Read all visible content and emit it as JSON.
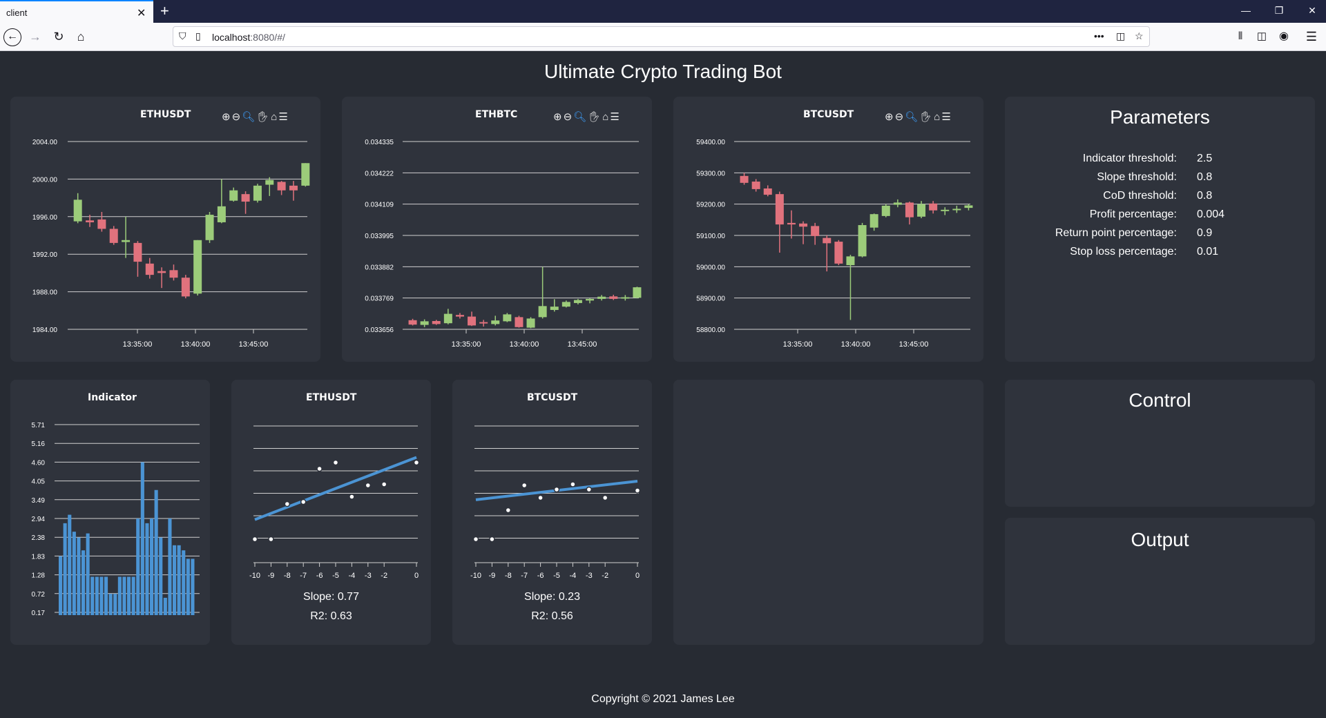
{
  "browser": {
    "tab_title": "client",
    "url_host": "localhost",
    "url_rest": ":8080/#/"
  },
  "app": {
    "title": "Ultimate Crypto Trading Bot",
    "footer": "Copyright © 2021 James Lee"
  },
  "colors": {
    "bull": "#9ccc7a",
    "bear": "#e1727d",
    "line": "#4b94d4",
    "background": "#272b33",
    "card": "#2f333c"
  },
  "parameters": {
    "title": "Parameters",
    "rows": [
      {
        "label": "Indicator threshold:",
        "value": "2.5"
      },
      {
        "label": "Slope threshold:",
        "value": "0.8"
      },
      {
        "label": "CoD threshold:",
        "value": "0.8"
      },
      {
        "label": "Profit percentage:",
        "value": "0.004"
      },
      {
        "label": "Return point percentage:",
        "value": "0.9"
      },
      {
        "label": "Stop loss percentage:",
        "value": "0.01"
      }
    ]
  },
  "control": {
    "title": "Control"
  },
  "output": {
    "title": "Output"
  },
  "chart_data": [
    {
      "type": "candlestick",
      "title": "ETHUSDT",
      "y_ticks": [
        "2004.00",
        "2000.00",
        "1996.00",
        "1992.00",
        "1988.00",
        "1984.00"
      ],
      "ylim": [
        1984,
        2004
      ],
      "x_ticks": [
        "13:35:00",
        "13:40:00",
        "13:45:00"
      ],
      "candles": [
        {
          "o": 1995.5,
          "h": 1998.5,
          "l": 1995.3,
          "c": 1997.8
        },
        {
          "o": 1995.6,
          "h": 1996.2,
          "l": 1994.9,
          "c": 1995.4
        },
        {
          "o": 1995.7,
          "h": 1996.5,
          "l": 1994.4,
          "c": 1994.7
        },
        {
          "o": 1994.7,
          "h": 1995.0,
          "l": 1993.0,
          "c": 1993.2
        },
        {
          "o": 1993.3,
          "h": 1996.0,
          "l": 1991.6,
          "c": 1993.5
        },
        {
          "o": 1993.2,
          "h": 1993.4,
          "l": 1989.6,
          "c": 1991.2
        },
        {
          "o": 1991.0,
          "h": 1991.6,
          "l": 1989.4,
          "c": 1989.8
        },
        {
          "o": 1990.2,
          "h": 1990.6,
          "l": 1988.4,
          "c": 1990.0
        },
        {
          "o": 1990.3,
          "h": 1990.9,
          "l": 1989.2,
          "c": 1989.5
        },
        {
          "o": 1989.5,
          "h": 1989.8,
          "l": 1987.3,
          "c": 1987.5
        },
        {
          "o": 1987.8,
          "h": 1993.5,
          "l": 1987.6,
          "c": 1993.5
        },
        {
          "o": 1993.5,
          "h": 1996.5,
          "l": 1993.2,
          "c": 1996.2
        },
        {
          "o": 1995.4,
          "h": 2000.0,
          "l": 1995.3,
          "c": 1997.1
        },
        {
          "o": 1997.7,
          "h": 1999.1,
          "l": 1997.6,
          "c": 1998.8
        },
        {
          "o": 1998.4,
          "h": 1998.7,
          "l": 1996.3,
          "c": 1997.6
        },
        {
          "o": 1997.7,
          "h": 1999.5,
          "l": 1997.5,
          "c": 1999.3
        },
        {
          "o": 1999.4,
          "h": 2000.2,
          "l": 1998.2,
          "c": 1999.9
        },
        {
          "o": 1999.7,
          "h": 1999.8,
          "l": 1998.3,
          "c": 1998.8
        },
        {
          "o": 1999.3,
          "h": 1999.8,
          "l": 1997.7,
          "c": 1998.8
        },
        {
          "o": 1999.3,
          "h": 2001.7,
          "l": 1999.2,
          "c": 2001.7
        }
      ]
    },
    {
      "type": "candlestick",
      "title": "ETHBTC",
      "y_ticks": [
        "0.034335",
        "0.034222",
        "0.034109",
        "0.033995",
        "0.033882",
        "0.033769",
        "0.033656"
      ],
      "ylim": [
        0.033656,
        0.034335
      ],
      "x_ticks": [
        "13:35:00",
        "13:40:00",
        "13:45:00"
      ],
      "candles": [
        {
          "o": 0.033689,
          "h": 0.033694,
          "l": 0.03367,
          "c": 0.033673
        },
        {
          "o": 0.033672,
          "h": 0.033692,
          "l": 0.033664,
          "c": 0.033685
        },
        {
          "o": 0.033686,
          "h": 0.03369,
          "l": 0.033672,
          "c": 0.033675
        },
        {
          "o": 0.033678,
          "h": 0.03373,
          "l": 0.033674,
          "c": 0.033712
        },
        {
          "o": 0.033708,
          "h": 0.033715,
          "l": 0.033695,
          "c": 0.033702
        },
        {
          "o": 0.033702,
          "h": 0.03372,
          "l": 0.033668,
          "c": 0.03367
        },
        {
          "o": 0.033682,
          "h": 0.03369,
          "l": 0.033666,
          "c": 0.033678
        },
        {
          "o": 0.033675,
          "h": 0.033705,
          "l": 0.03367,
          "c": 0.033688
        },
        {
          "o": 0.033685,
          "h": 0.033715,
          "l": 0.033682,
          "c": 0.03371
        },
        {
          "o": 0.0337,
          "h": 0.033705,
          "l": 0.033662,
          "c": 0.033664
        },
        {
          "o": 0.033662,
          "h": 0.0337,
          "l": 0.03366,
          "c": 0.033695
        },
        {
          "o": 0.0337,
          "h": 0.033882,
          "l": 0.033695,
          "c": 0.03374
        },
        {
          "o": 0.033726,
          "h": 0.033765,
          "l": 0.03372,
          "c": 0.033738
        },
        {
          "o": 0.033738,
          "h": 0.03376,
          "l": 0.033735,
          "c": 0.033755
        },
        {
          "o": 0.033751,
          "h": 0.033766,
          "l": 0.033746,
          "c": 0.033762
        },
        {
          "o": 0.03376,
          "h": 0.033768,
          "l": 0.03375,
          "c": 0.033766
        },
        {
          "o": 0.033766,
          "h": 0.03378,
          "l": 0.03376,
          "c": 0.033774
        },
        {
          "o": 0.033775,
          "h": 0.033781,
          "l": 0.033762,
          "c": 0.033766
        },
        {
          "o": 0.033768,
          "h": 0.03378,
          "l": 0.03376,
          "c": 0.033772
        },
        {
          "o": 0.03377,
          "h": 0.03381,
          "l": 0.033768,
          "c": 0.033808
        }
      ]
    },
    {
      "type": "candlestick",
      "title": "BTCUSDT",
      "y_ticks": [
        "59400.00",
        "59300.00",
        "59200.00",
        "59100.00",
        "59000.00",
        "58900.00",
        "58800.00"
      ],
      "ylim": [
        58800,
        59400
      ],
      "x_ticks": [
        "13:35:00",
        "13:40:00",
        "13:45:00"
      ],
      "candles": [
        {
          "o": 59290,
          "h": 59300,
          "l": 59262,
          "c": 59268
        },
        {
          "o": 59272,
          "h": 59280,
          "l": 59240,
          "c": 59248
        },
        {
          "o": 59250,
          "h": 59260,
          "l": 59225,
          "c": 59230
        },
        {
          "o": 59232,
          "h": 59240,
          "l": 59045,
          "c": 59135
        },
        {
          "o": 59140,
          "h": 59180,
          "l": 59090,
          "c": 59135
        },
        {
          "o": 59138,
          "h": 59145,
          "l": 59072,
          "c": 59128
        },
        {
          "o": 59130,
          "h": 59140,
          "l": 59070,
          "c": 59098
        },
        {
          "o": 59092,
          "h": 59100,
          "l": 58985,
          "c": 59075
        },
        {
          "o": 59080,
          "h": 59085,
          "l": 59005,
          "c": 59010
        },
        {
          "o": 59005,
          "h": 59038,
          "l": 58830,
          "c": 59033
        },
        {
          "o": 59033,
          "h": 59140,
          "l": 59030,
          "c": 59133
        },
        {
          "o": 59125,
          "h": 59170,
          "l": 59115,
          "c": 59168
        },
        {
          "o": 59162,
          "h": 59200,
          "l": 59158,
          "c": 59195
        },
        {
          "o": 59198,
          "h": 59215,
          "l": 59190,
          "c": 59205
        },
        {
          "o": 59205,
          "h": 59208,
          "l": 59135,
          "c": 59158
        },
        {
          "o": 59160,
          "h": 59210,
          "l": 59155,
          "c": 59200
        },
        {
          "o": 59202,
          "h": 59210,
          "l": 59170,
          "c": 59180
        },
        {
          "o": 59180,
          "h": 59190,
          "l": 59165,
          "c": 59182
        },
        {
          "o": 59182,
          "h": 59195,
          "l": 59172,
          "c": 59185
        },
        {
          "o": 59188,
          "h": 59200,
          "l": 59180,
          "c": 59196
        }
      ]
    },
    {
      "type": "bar",
      "title": "Indicator",
      "y_ticks": [
        "5.71",
        "5.16",
        "4.60",
        "4.05",
        "3.49",
        "2.94",
        "2.38",
        "1.83",
        "1.28",
        "0.72",
        "0.17"
      ],
      "ylim": [
        0.17,
        5.71
      ],
      "values": [
        1.83,
        2.8,
        3.05,
        2.55,
        2.38,
        2.0,
        2.5,
        1.22,
        1.22,
        1.22,
        1.22,
        0.72,
        0.72,
        1.22,
        1.22,
        1.22,
        1.22,
        2.94,
        4.6,
        2.8,
        2.94,
        3.78,
        2.38,
        0.6,
        2.94,
        2.15,
        2.15,
        2.0,
        1.75,
        1.75
      ]
    },
    {
      "type": "scatter",
      "title": "ETHUSDT",
      "x_ticks": [
        "-10",
        "-9",
        "-8",
        "-7",
        "-6",
        "-5",
        "-4",
        "-3",
        "-2",
        "0"
      ],
      "xlim": [
        -10,
        0
      ],
      "points": [
        [
          -10,
          0.3
        ],
        [
          -9,
          0.3
        ],
        [
          -8,
          2.0
        ],
        [
          -7,
          2.1
        ],
        [
          -6,
          3.7
        ],
        [
          -5,
          4.0
        ],
        [
          -4,
          2.35
        ],
        [
          -3,
          2.9
        ],
        [
          -2,
          2.95
        ],
        [
          0,
          4.0
        ]
      ],
      "line": {
        "slope": 0.77,
        "intercept": 4.25
      },
      "slope_text": "Slope: 0.77",
      "r2_text": "R2: 0.63"
    },
    {
      "type": "scatter",
      "title": "BTCUSDT",
      "x_ticks": [
        "-10",
        "-9",
        "-8",
        "-7",
        "-6",
        "-5",
        "-4",
        "-3",
        "-2",
        "0"
      ],
      "xlim": [
        -10,
        0
      ],
      "points": [
        [
          -10,
          0.3
        ],
        [
          -9,
          0.3
        ],
        [
          -8,
          1.7
        ],
        [
          -7,
          2.9
        ],
        [
          -6,
          2.3
        ],
        [
          -5,
          2.7
        ],
        [
          -4,
          2.95
        ],
        [
          -3,
          2.7
        ],
        [
          -2,
          2.3
        ],
        [
          0,
          2.65
        ]
      ],
      "line": {
        "slope": 0.23,
        "intercept": 3.1
      },
      "slope_text": "Slope: 0.23",
      "r2_text": "R2: 0.56"
    }
  ]
}
